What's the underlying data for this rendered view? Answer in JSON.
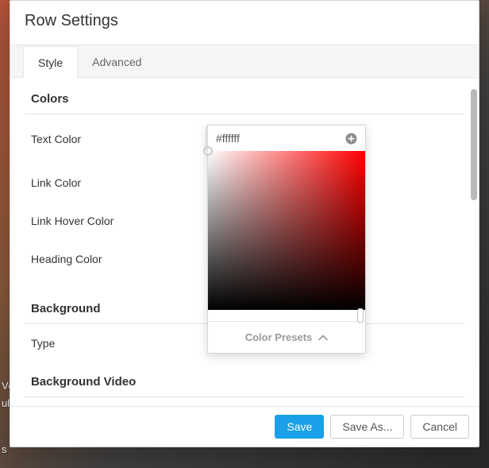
{
  "modal": {
    "title": "Row Settings",
    "tabs": {
      "style": "Style",
      "advanced": "Advanced"
    }
  },
  "sections": {
    "colors_title": "Colors",
    "background_title": "Background",
    "background_video_title": "Background Video"
  },
  "fields": {
    "text_color": "Text Color",
    "link_color": "Link Color",
    "link_hover_color": "Link Hover Color",
    "heading_color": "Heading Color",
    "type": "Type"
  },
  "picker": {
    "hex_value": "#ffffff",
    "presets_label": "Color Presets"
  },
  "buttons": {
    "save": "Save",
    "save_as": "Save As...",
    "cancel": "Cancel"
  },
  "bg_text": {
    "l1": "Vc",
    "l2": "ulamcorper sit amet, accumsan ac sapien. Donec non tellus justo. Duis sagittis, nulla non pret",
    "l3": "s"
  },
  "icons": {
    "close": "×"
  },
  "colors": {
    "primary": "#1aa0e8",
    "hue_base": "#ff0000"
  }
}
